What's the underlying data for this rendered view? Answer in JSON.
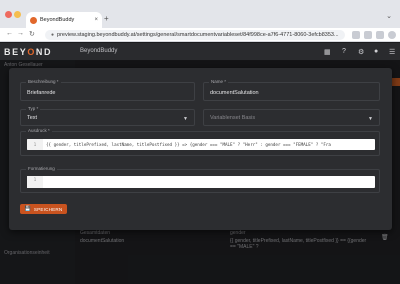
{
  "browser": {
    "tab_title": "BeyondBuddy",
    "url": "preview.staging.beyondbuddy.at/settings/general/smartdocumentvariableset/84f998ce-a7f6-4771-8060-3efcb8353...",
    "tab_close": "×",
    "new_tab": "+",
    "chevron": "⌄"
  },
  "app": {
    "logo_prefix": "BEY",
    "logo_o": "O",
    "logo_suffix": "ND",
    "name": "BeyondBuddy"
  },
  "background": {
    "side_items": [
      "Anton Gesellauer",
      "Organisationseinheit"
    ],
    "row_label": "documentSalutation",
    "row_value": "{{ gender, titlePrefixed, lastName, titlePostfixed }} == {{gender == \"MALE\" ?",
    "row_label_partial": "Gesamtdaten",
    "row_value_partial": "gender"
  },
  "modal": {
    "description": {
      "label": "Beschreibung *",
      "value": "Briefanrede"
    },
    "name": {
      "label": "Name *",
      "value": "documentSalutation"
    },
    "type": {
      "label": "Typ *",
      "value": "Text"
    },
    "basis": {
      "placeholder": "Variablenset Basis"
    },
    "expression": {
      "label": "Ausdruck *",
      "line": "1",
      "code": "{{ gender, titlePrefixed, lastName, titlePostfixed }} => {gender === \"MALE\" ? \"Herr\" : gender === \"FEMALE\" ? \"Fra"
    },
    "formatting": {
      "label": "Formatierung",
      "line": "1"
    },
    "save_label": "SPEICHERN"
  }
}
